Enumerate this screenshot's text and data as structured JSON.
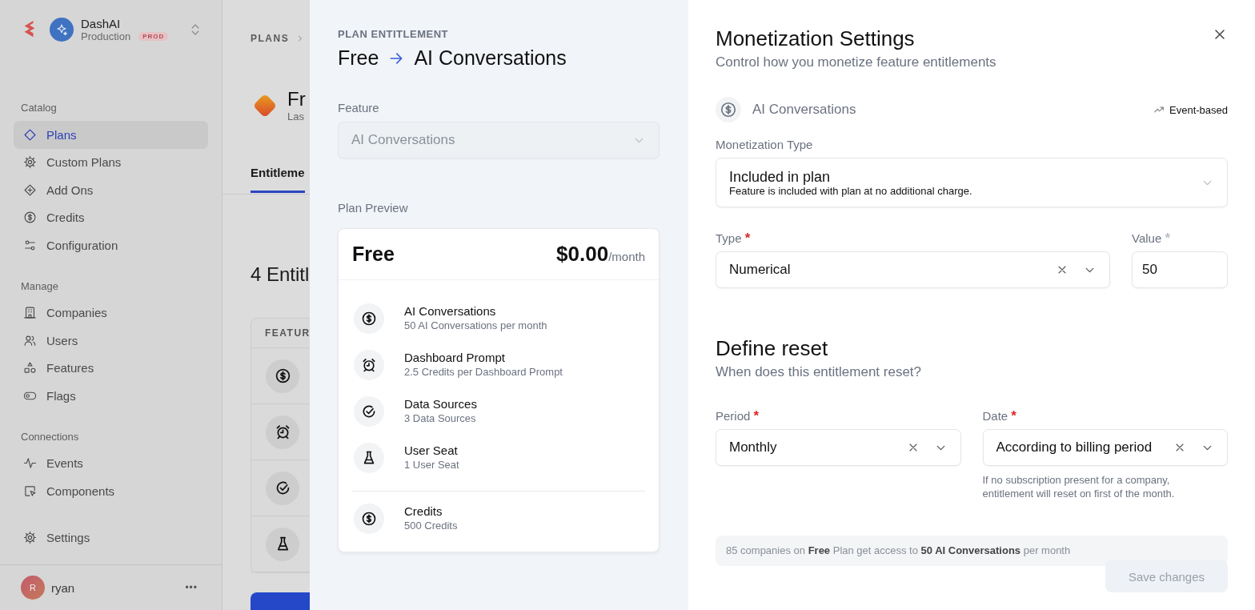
{
  "sidebar": {
    "org": {
      "name": "DashAI",
      "environment": "Production",
      "badge": "PROD"
    },
    "sections": [
      {
        "title": "Catalog",
        "items": [
          {
            "label": "Plans",
            "kind": "diamond",
            "selected": true
          },
          {
            "label": "Custom Plans",
            "kind": "gear",
            "selected": false
          },
          {
            "label": "Add Ons",
            "kind": "plusdiamond",
            "selected": false
          },
          {
            "label": "Credits",
            "kind": "dollar",
            "selected": false
          },
          {
            "label": "Configuration",
            "kind": "sliders",
            "selected": false
          }
        ]
      },
      {
        "title": "Manage",
        "items": [
          {
            "label": "Companies",
            "kind": "building",
            "selected": false
          },
          {
            "label": "Users",
            "kind": "users",
            "selected": false
          },
          {
            "label": "Features",
            "kind": "shapes",
            "selected": false
          },
          {
            "label": "Flags",
            "kind": "toggle",
            "selected": false
          }
        ]
      },
      {
        "title": "Connections",
        "items": [
          {
            "label": "Events",
            "kind": "activity",
            "selected": false
          },
          {
            "label": "Components",
            "kind": "component",
            "selected": false
          }
        ]
      },
      {
        "items": [
          {
            "label": "Settings",
            "kind": "gear",
            "selected": false
          }
        ]
      }
    ],
    "user": {
      "initial": "R",
      "name": "ryan",
      "menu": "•••"
    }
  },
  "plan_page": {
    "breadcrumb": "PLANS",
    "plan_title": "Fr",
    "plan_subtitle": "Las",
    "tab": {
      "label": "Entitleme",
      "selected": true
    },
    "heading": "4 Entitl",
    "table": {
      "columns": [
        "FEATUR"
      ],
      "rows": [
        {
          "kind": "dollar"
        },
        {
          "kind": "alarm"
        },
        {
          "kind": "check"
        },
        {
          "kind": "flask"
        }
      ]
    }
  },
  "entitlement_panel": {
    "eyebrow": "PLAN ENTITLEMENT",
    "plan": "Free",
    "feature": "AI Conversations",
    "feature_field": {
      "label": "Feature",
      "value": "AI Conversations",
      "disabled": true
    },
    "preview": {
      "label": "Plan Preview",
      "plan": "Free",
      "price": "$0.00",
      "period": "/month",
      "entitlements": [
        {
          "kind": "dollar",
          "name": "AI Conversations",
          "detail": "50 AI Conversations per month"
        },
        {
          "kind": "alarm",
          "name": "Dashboard Prompt",
          "detail": "2.5 Credits per Dashboard Prompt"
        },
        {
          "kind": "check",
          "name": "Data Sources",
          "detail": "3 Data Sources"
        },
        {
          "kind": "flask",
          "name": "User Seat",
          "detail": "1 User Seat"
        }
      ],
      "credits": [
        {
          "kind": "dollar",
          "name": "Credits",
          "detail": "500 Credits"
        }
      ]
    }
  },
  "monetization": {
    "title": "Monetization Settings",
    "subtitle": "Control how you monetize feature entitlements",
    "feature": {
      "kind": "dollar",
      "name": "AI Conversations"
    },
    "metering": "Event-based",
    "monetization_type": {
      "label": "Monetization Type",
      "value": "Included in plan",
      "description": "Feature is included with plan at no additional charge."
    },
    "fields": [
      {
        "label": "Type",
        "required_mark": "*",
        "color": "#dc2626",
        "kind": "select",
        "value": "Numerical",
        "clearable": true
      },
      {
        "label": "Value",
        "required_mark": "*",
        "color": "#b9bdc4",
        "kind": "input",
        "value": "50"
      }
    ],
    "reset": {
      "title": "Define reset",
      "subtitle": "When does this entitlement reset?",
      "fields": [
        {
          "label": "Period",
          "required_mark": "*",
          "color": "#dc2626",
          "kind": "select",
          "value": "Monthly",
          "clearable": true
        },
        {
          "label": "Date",
          "required_mark": "*",
          "color": "#dc2626",
          "kind": "select",
          "value": "According to billing period",
          "clearable": true,
          "hint": "If no subscription present for a company, entitlement will reset on first of the month."
        }
      ]
    },
    "summary": "85 companies on **Free** Plan get access to **50 AI Conversations** per month",
    "save": {
      "label": "Save changes",
      "disabled": true
    }
  }
}
